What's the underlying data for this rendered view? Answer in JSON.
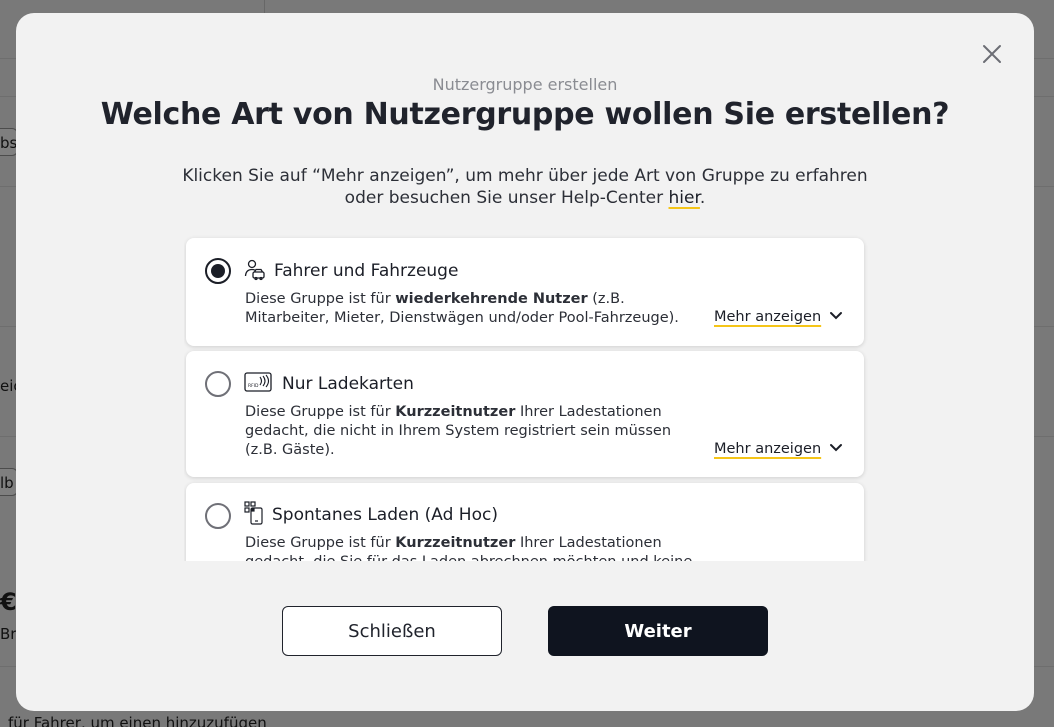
{
  "background": {
    "fragments": [
      "bs",
      "eic",
      "lb",
      "€",
      "Bru"
    ],
    "footer_text": "für Fahrer, um einen hinzuzufügen"
  },
  "modal": {
    "subtitle": "Nutzergruppe erstellen",
    "title": "Welche Art von Nutzergruppe wollen Sie erstellen?",
    "description_before": "Klicken Sie auf “Mehr anzeigen”, um mehr über jede Art von Gruppe zu erfahren oder besuchen Sie unser Help-Center ",
    "description_link": "hier",
    "description_after": ".",
    "close_icon": "close-icon",
    "options": [
      {
        "title": "Fahrer und Fahrzeuge",
        "icon": "driver-car-icon",
        "selected": true,
        "text_before": "Diese Gruppe ist für ",
        "text_bold": "wiederkehrende Nutzer",
        "text_after": " (z.B. Mitarbeiter, Mieter, Dienstwägen und/oder Pool-Fahrzeuge).",
        "more": "Mehr anzeigen"
      },
      {
        "title": "Nur Ladekarten",
        "icon": "rfid-card-icon",
        "selected": false,
        "text_before": "Diese Gruppe ist für ",
        "text_bold": "Kurzzeitnutzer",
        "text_after": " Ihrer Ladestationen gedacht, die nicht in Ihrem System registriert sein müssen (z.B. Gäste).",
        "more": "Mehr anzeigen"
      },
      {
        "title": "Spontanes Laden (Ad Hoc)",
        "icon": "qr-phone-icon",
        "selected": false,
        "text_before": "Diese Gruppe ist für ",
        "text_bold": "Kurzzeitnutzer",
        "text_after": " Ihrer Ladestationen gedacht, die Sie für das Laden abrechnen möchten und keine",
        "more": ""
      }
    ],
    "buttons": {
      "close": "Schließen",
      "next": "Weiter"
    }
  }
}
